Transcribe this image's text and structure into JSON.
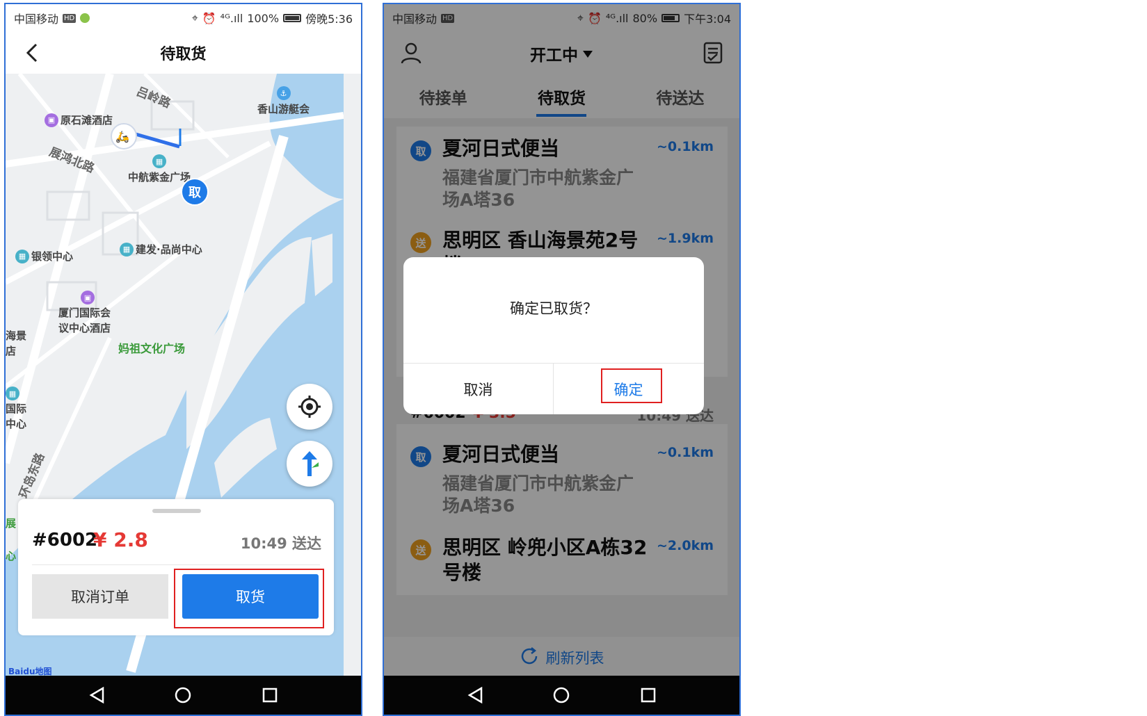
{
  "screen1": {
    "status": {
      "carrier": "中国移动",
      "hd": "HD",
      "signal": "⁴ᴳ.ıll",
      "battery": "100%",
      "time": "傍晚5:36"
    },
    "title": "待取货",
    "map": {
      "roads": {
        "road1": "吕岭路",
        "road2": "展鸿北路",
        "road3": "环岛东路"
      },
      "pois": {
        "hotel1": "原石滩酒店",
        "yacht": "香山游艇会",
        "zhonghang": "中航紫金广场",
        "jianfa": "建发·品尚中心",
        "yinling": "银领中心",
        "intl_hotel_1": "厦门国际会",
        "intl_hotel_2": "议中心酒店",
        "haijing_1": "海景",
        "haijing_2": "店",
        "intl_1": "国际",
        "intl_2": "中心",
        "edge_1": "展",
        "edge_2": "心"
      },
      "green_label": "妈祖文化广场",
      "pickup_marker": "取",
      "baidu_logo": "Baidu地图"
    },
    "order": {
      "number": "#6002",
      "price": "¥ 2.8",
      "eta": "10:49 送达"
    },
    "buttons": {
      "cancel_order": "取消订单",
      "pickup": "取货"
    }
  },
  "screen2": {
    "status": {
      "carrier": "中国移动",
      "hd": "HD",
      "signal": "⁴ᴳ.ıll",
      "battery": "80%",
      "time": "下午3:04"
    },
    "title": "开工中",
    "tabs": [
      "待接单",
      "待取货",
      "待送达"
    ],
    "cards": [
      {
        "pick": {
          "badge": "取",
          "name": "夏河日式便当",
          "addr": "福建省厦门市中航紫金广场A塔36",
          "dist": "~0.1km"
        },
        "send": {
          "badge": "送",
          "name": "思明区 香山海景苑2号楼",
          "dist": "~1.9km"
        }
      },
      {
        "pick": {
          "badge": "取",
          "name": "夏河日式便当",
          "addr": "福建省厦门市中航紫金广场A塔36",
          "dist": "~0.1km"
        },
        "send": {
          "badge": "送",
          "name": "思明区 岭兜小区A栋32号楼",
          "dist": "~2.0km"
        }
      }
    ],
    "refresh": "刷新列表",
    "dialog": {
      "message": "确定已取货？",
      "cancel": "取消",
      "ok": "确定"
    },
    "hidden_row": {
      "number": "#6002",
      "price": "¥ 3.5",
      "eta": "10:49 送达"
    }
  },
  "colors": {
    "accent": "#1e7be8",
    "price": "#e53935",
    "highlight": "#e02020",
    "pickup_badge": "#1e7be8",
    "send_badge": "#f0a020"
  }
}
